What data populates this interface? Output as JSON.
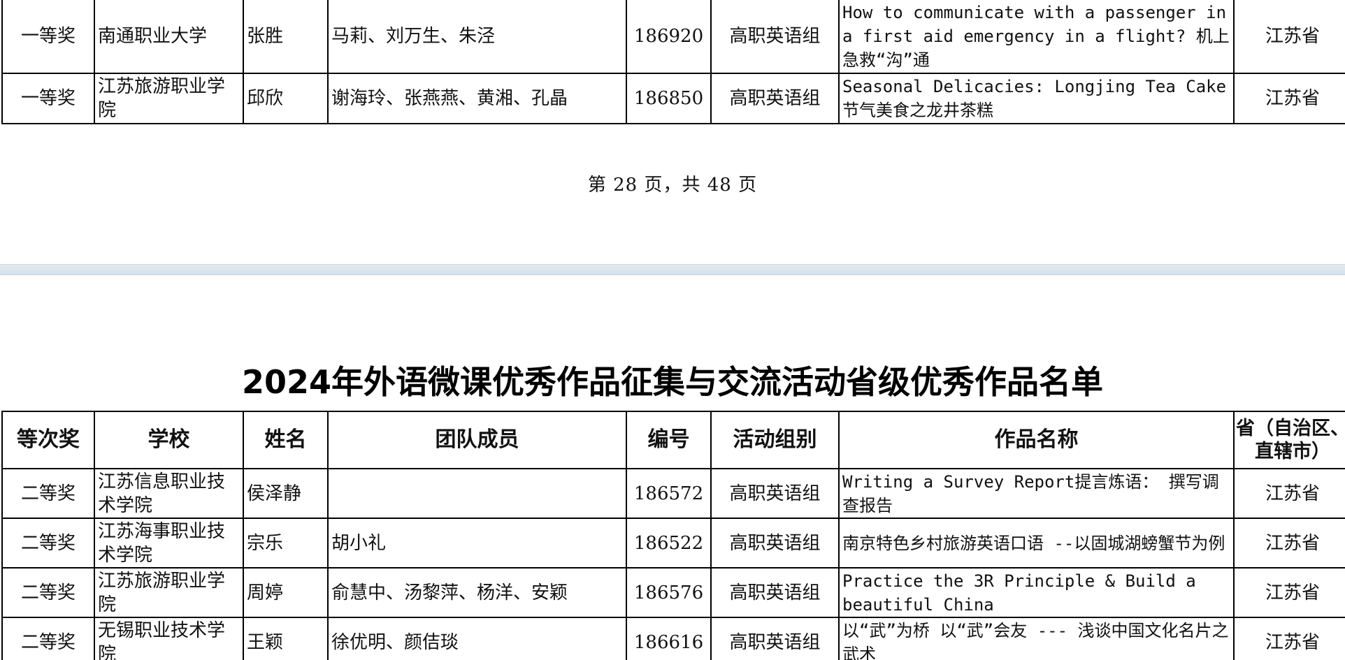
{
  "page1": {
    "rows": [
      {
        "award": "一等奖",
        "school": "南通职业大学",
        "name": "张胜",
        "team": "马莉、刘万生、朱泾",
        "id": "186920",
        "group": "高职英语组",
        "title": "How to communicate with a passenger in a first aid emergency in a flight? 机上急救“沟”通",
        "province": "江苏省"
      },
      {
        "award": "一等奖",
        "school": "江苏旅游职业学院",
        "name": "邱欣",
        "team": "谢海玲、张燕燕、黄湘、孔晶",
        "id": "186850",
        "group": "高职英语组",
        "title": "Seasonal Delicacies: Longjing Tea Cake 节气美食之龙井茶糕",
        "province": "江苏省"
      }
    ],
    "page_number": "第 28 页，共 48 页"
  },
  "page2": {
    "title": "2024年外语微课优秀作品征集与交流活动省级优秀作品名单",
    "headers": {
      "award": "等次奖",
      "school": "学校",
      "name": "姓名",
      "team": "团队成员",
      "id": "编号",
      "group": "活动组别",
      "title": "作品名称",
      "province": "省（自治区、直辖市）"
    },
    "rows": [
      {
        "award": "二等奖",
        "school": "江苏信息职业技术学院",
        "name": "侯泽静",
        "team": "",
        "id": "186572",
        "group": "高职英语组",
        "title": "Writing a Survey Report提言炼语： 撰写调查报告",
        "province": "江苏省"
      },
      {
        "award": "二等奖",
        "school": "江苏海事职业技术学院",
        "name": "宗乐",
        "team": "胡小礼",
        "id": "186522",
        "group": "高职英语组",
        "title": "南京特色乡村旅游英语口语 --以固城湖螃蟹节为例",
        "province": "江苏省"
      },
      {
        "award": "二等奖",
        "school": "江苏旅游职业学院",
        "name": "周婷",
        "team": "俞慧中、汤黎萍、杨洋、安颖",
        "id": "186576",
        "group": "高职英语组",
        "title": "Practice the 3R Principle & Build a beautiful China",
        "province": "江苏省"
      },
      {
        "award": "二等奖",
        "school": "无锡职业技术学院",
        "name": "王颖",
        "team": "徐优明、颜佶琰",
        "id": "186616",
        "group": "高职英语组",
        "title": "以“武”为桥 以“武”会友 --- 浅谈中国文化名片之武术",
        "province": "江苏省"
      }
    ]
  }
}
